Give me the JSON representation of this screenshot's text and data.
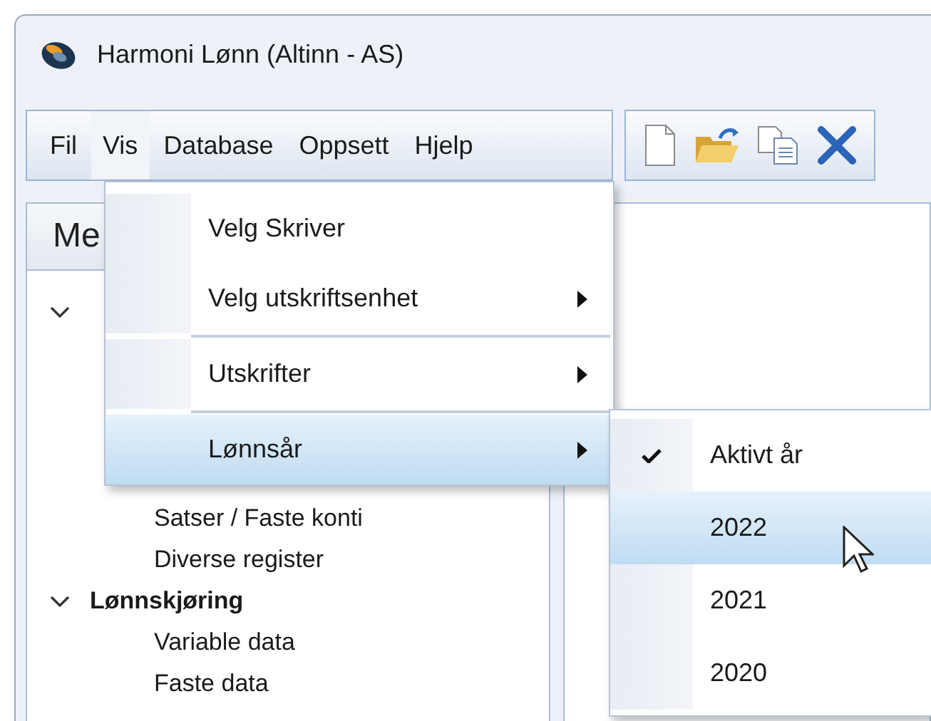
{
  "window": {
    "title": "Harmoni Lønn (Altinn - AS)"
  },
  "menubar": [
    {
      "label": "Fil",
      "selected": false
    },
    {
      "label": "Vis",
      "selected": true
    },
    {
      "label": "Database",
      "selected": false
    },
    {
      "label": "Oppsett",
      "selected": false
    },
    {
      "label": "Hjelp",
      "selected": false
    }
  ],
  "left_panel": {
    "header": "Me",
    "tree": [
      {
        "expanded": true,
        "children": [
          {
            "label": "Satser / Faste konti"
          },
          {
            "label": "Diverse register"
          }
        ]
      },
      {
        "label": "Lønnskjøring",
        "expanded": true,
        "children": [
          {
            "label": "Variable data"
          },
          {
            "label": "Faste data"
          }
        ]
      }
    ]
  },
  "vis_menu": [
    {
      "kind": "item",
      "label": "Velg Skriver",
      "submenu": false,
      "selected": false
    },
    {
      "kind": "item",
      "label": "Velg utskriftsenhet",
      "submenu": true,
      "selected": false
    },
    {
      "kind": "separator"
    },
    {
      "kind": "item",
      "label": "Utskrifter",
      "submenu": true,
      "selected": false
    },
    {
      "kind": "separator"
    },
    {
      "kind": "item",
      "label": "Lønnsår",
      "submenu": true,
      "selected": true
    }
  ],
  "lonnsar_menu": [
    {
      "label": "Aktivt år",
      "checked": true,
      "selected": false
    },
    {
      "label": "2022",
      "checked": false,
      "selected": true
    },
    {
      "label": "2021",
      "checked": false,
      "selected": false
    },
    {
      "label": "2020",
      "checked": false,
      "selected": false
    }
  ]
}
